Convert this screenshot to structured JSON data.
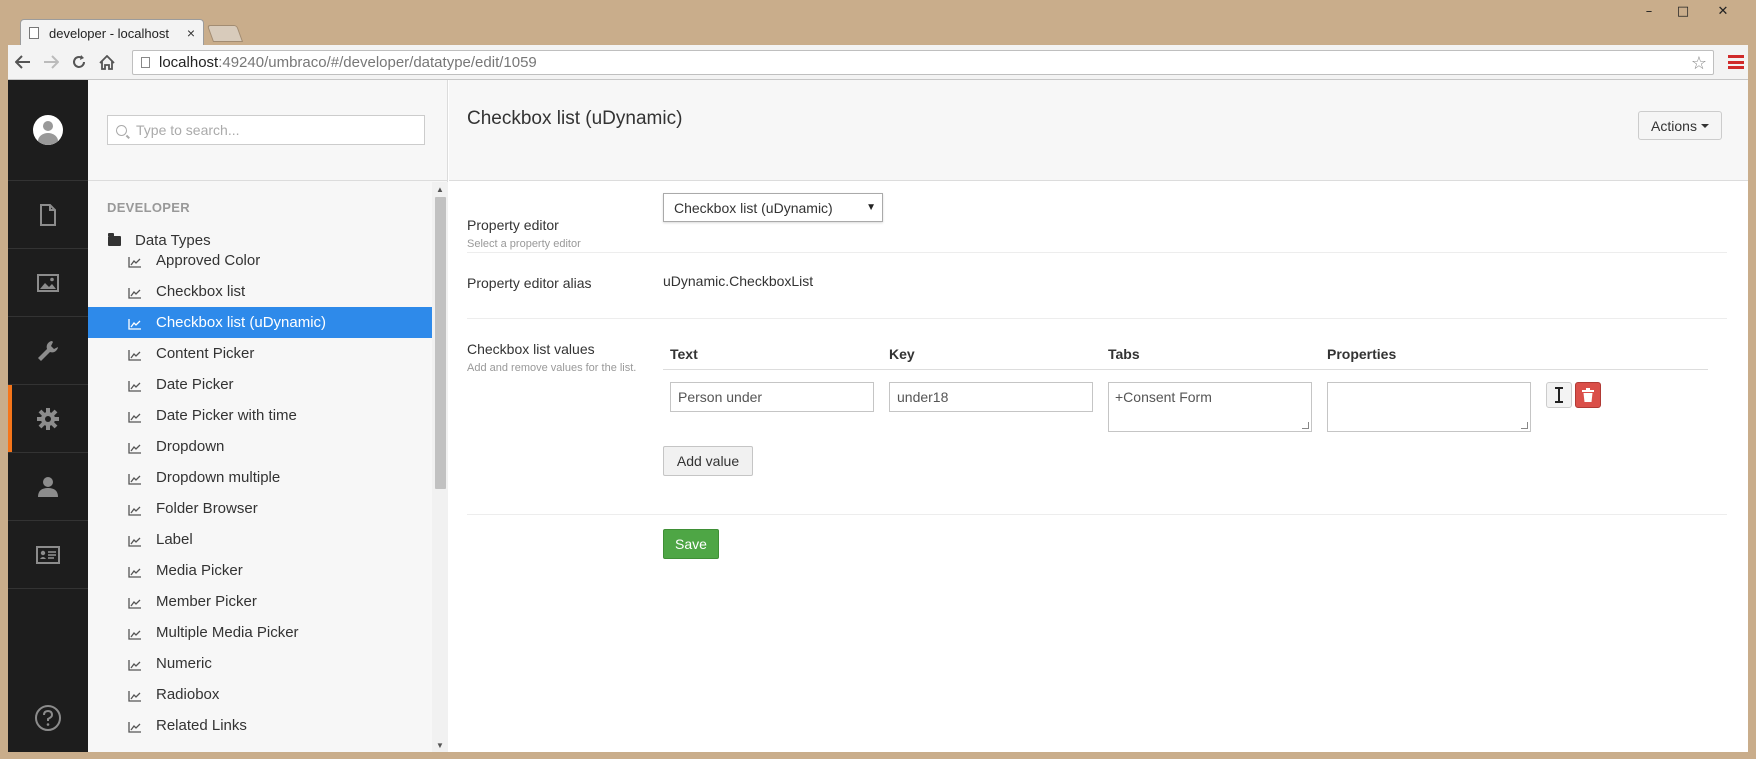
{
  "browser": {
    "tab_title": "developer - localhost",
    "tab_close": "×",
    "url_host": "localhost",
    "url_rest": ":49240/umbraco/#/developer/datatype/edit/1059",
    "win_minimize": "–",
    "win_maximize": "□",
    "win_close": "✕"
  },
  "search": {
    "placeholder": "Type to search..."
  },
  "tree": {
    "heading": "DEVELOPER",
    "root_label": "Data Types",
    "items": [
      {
        "label": "Approved Color"
      },
      {
        "label": "Checkbox list"
      },
      {
        "label": "Checkbox list (uDynamic)"
      },
      {
        "label": "Content Picker"
      },
      {
        "label": "Date Picker"
      },
      {
        "label": "Date Picker with time"
      },
      {
        "label": "Dropdown"
      },
      {
        "label": "Dropdown multiple"
      },
      {
        "label": "Folder Browser"
      },
      {
        "label": "Label"
      },
      {
        "label": "Media Picker"
      },
      {
        "label": "Member Picker"
      },
      {
        "label": "Multiple Media Picker"
      },
      {
        "label": "Numeric"
      },
      {
        "label": "Radiobox"
      },
      {
        "label": "Related Links"
      }
    ],
    "selected_index": 2
  },
  "editor": {
    "title": "Checkbox list (uDynamic)",
    "actions_label": "Actions",
    "property_editor": {
      "label": "Property editor",
      "description": "Select a property editor",
      "selected": "Checkbox list (uDynamic)"
    },
    "alias": {
      "label": "Property editor alias",
      "value": "uDynamic.CheckboxList"
    },
    "values": {
      "label": "Checkbox list values",
      "description": "Add and remove values for the list.",
      "columns": {
        "text": "Text",
        "key": "Key",
        "tabs": "Tabs",
        "properties": "Properties"
      },
      "row": {
        "text": "Person under",
        "key": "under18",
        "tabs": "+Consent Form",
        "properties": ""
      },
      "add_label": "Add value"
    },
    "save_label": "Save"
  },
  "colors": {
    "selected_item": "#2e8aea",
    "active_section": "#f5751a",
    "save_button": "#4ea645",
    "delete_button": "#da4f49"
  }
}
